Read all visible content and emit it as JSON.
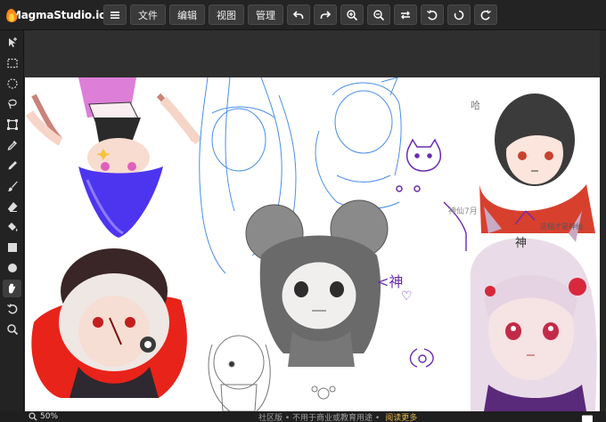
{
  "app": {
    "name": "MagmaStudio.io",
    "accent": "#ff8a1a"
  },
  "toolbar": {
    "menu_icon": "hamburger-icon",
    "file_label": "文件",
    "edit_label": "编辑",
    "view_label": "视图",
    "manage_label": "管理",
    "icons": [
      "undo-icon",
      "redo-icon",
      "zoom-in-icon",
      "zoom-out-icon",
      "swap-icon",
      "rotate-left-icon",
      "circle-icon",
      "rotate-right-icon"
    ]
  },
  "tools": [
    {
      "name": "move-tool",
      "icon": "move-icon"
    },
    {
      "name": "rect-select-tool",
      "icon": "rect-select-icon"
    },
    {
      "name": "ellipse-select-tool",
      "icon": "ellipse-select-icon"
    },
    {
      "name": "lasso-tool",
      "icon": "lasso-icon"
    },
    {
      "name": "transform-tool",
      "icon": "transform-icon"
    },
    {
      "name": "eyedropper-tool",
      "icon": "eyedropper-icon"
    },
    {
      "name": "pencil-tool",
      "icon": "pencil-icon"
    },
    {
      "name": "brush-tool",
      "icon": "brush-icon"
    },
    {
      "name": "eraser-tool",
      "icon": "eraser-icon"
    },
    {
      "name": "fill-tool",
      "icon": "bucket-icon"
    },
    {
      "name": "rectangle-tool",
      "icon": "square-icon"
    },
    {
      "name": "ellipse-tool",
      "icon": "dot-icon"
    },
    {
      "name": "hand-tool",
      "icon": "hand-icon",
      "active": true
    },
    {
      "name": "rotate-view-tool",
      "icon": "rotate-icon"
    },
    {
      "name": "zoom-tool",
      "icon": "magnifier-icon"
    }
  ],
  "status": {
    "zoom": "50%",
    "notice": "社区版 • 不用于商业或教育用途 •",
    "notice_link": "阅读更多"
  },
  "canvas_text": {
    "shen_left": "<神",
    "shen_right": "神",
    "heart": "♡",
    "note_right": "神仙7月",
    "note_small": "这個才是神仙",
    "ha": "哈"
  }
}
